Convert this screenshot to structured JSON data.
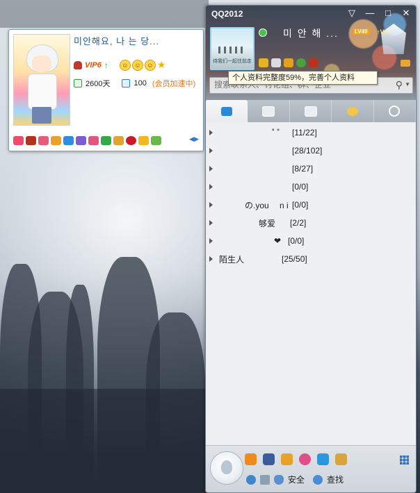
{
  "window": {
    "title": "QQ2012",
    "buttons": [
      "▽",
      "—",
      "□",
      "✕"
    ]
  },
  "profile": {
    "nickname": "미안해요, 나 는 당...",
    "vip": "VIP6",
    "days": "2600天",
    "level": "100",
    "accel": "(会员加速中)",
    "smileys": [
      "☺",
      "☺",
      "☺"
    ]
  },
  "header": {
    "nickname": "미 안 해 ...",
    "level_badge": "LV49",
    "svip": "↑VIP",
    "avatar_caption": "待我们一起往前走"
  },
  "search": {
    "placeholder": "搜索联系人、讨论组、群、企业"
  },
  "tooltip": "个人资料完整度59%，完善个人资料",
  "groups": [
    {
      "name": "˚ ˚",
      "count": "[11/22]"
    },
    {
      "name": "",
      "count": "[28/102]"
    },
    {
      "name": "",
      "count": "[8/27]"
    },
    {
      "name": "",
      "count": "[0/0]"
    },
    {
      "name": "の.you 　n i",
      "count": "[0/0]"
    },
    {
      "name": "够爱",
      "count": "[2/2]"
    },
    {
      "name": "❤",
      "count": "[0/0]"
    },
    {
      "name": "陌生人",
      "count": "[25/50]"
    }
  ],
  "bottom": {
    "security": "安全",
    "find": "查找"
  },
  "colors": {
    "accent": "#1a5aa8",
    "vip": "#e05000",
    "accel": "#e8751a",
    "online": "#47c24a"
  }
}
